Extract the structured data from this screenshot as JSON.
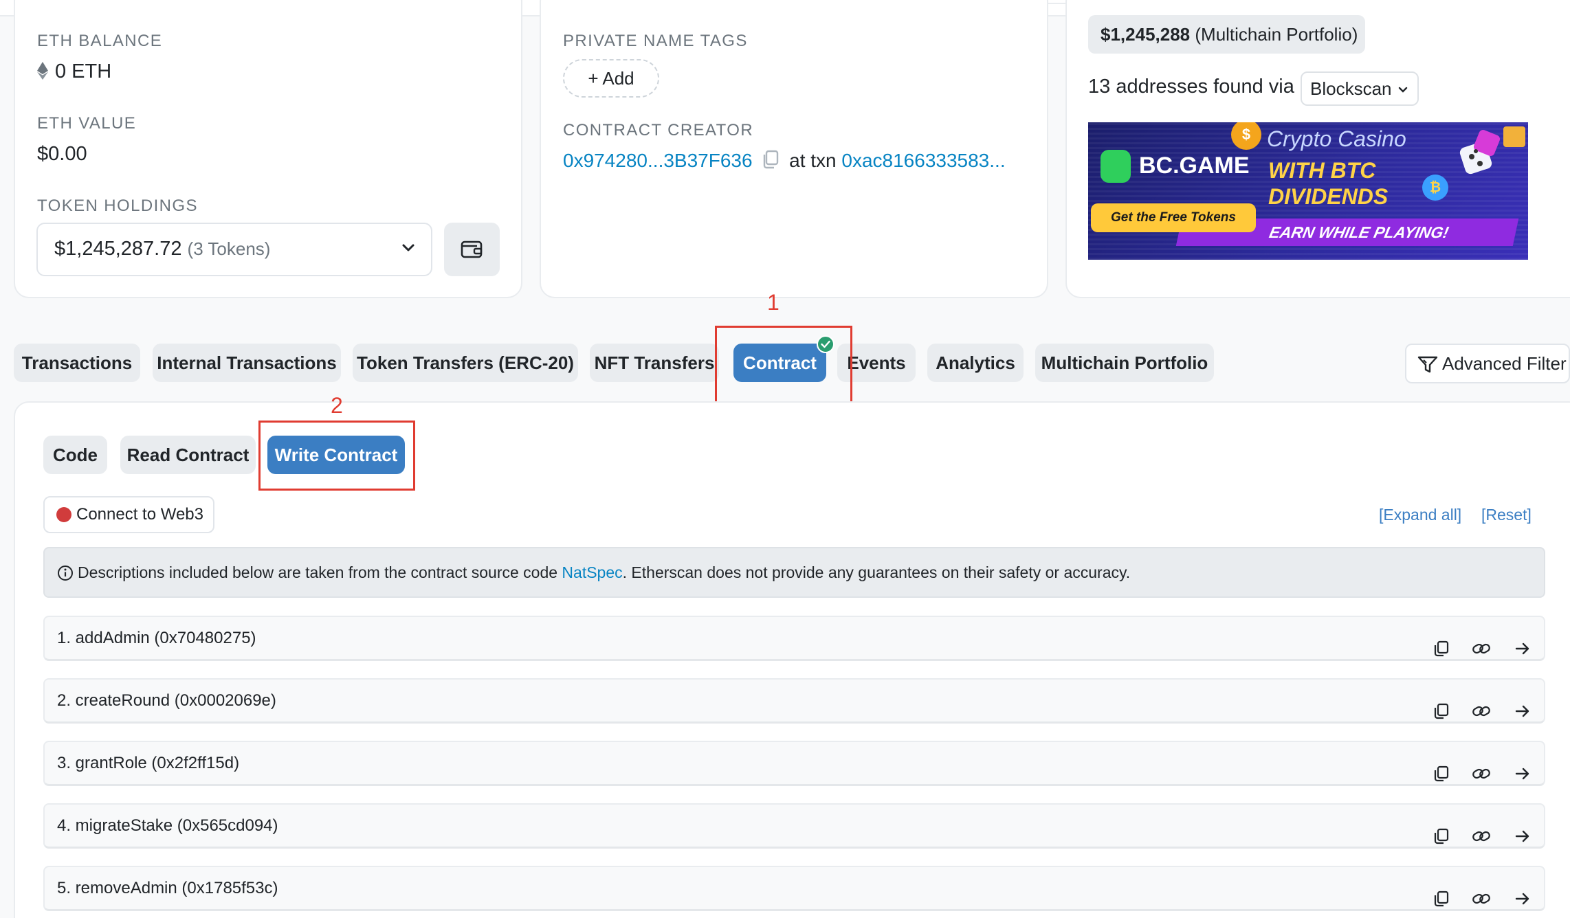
{
  "overview": {
    "eth_balance_label": "ETH BALANCE",
    "eth_balance_value": "0 ETH",
    "eth_value_label": "ETH VALUE",
    "eth_value_value": "$0.00",
    "token_holdings_label": "TOKEN HOLDINGS",
    "token_holdings_value": "$1,245,287.72",
    "token_holdings_count": "(3 Tokens)"
  },
  "more_info": {
    "private_tags_label": "PRIVATE NAME TAGS",
    "add_label": "Add",
    "creator_label": "CONTRACT CREATOR",
    "creator_address": "0x974280...3B37F636",
    "at_txn": "at txn",
    "creator_txn": "0xac8166333583..."
  },
  "multichain": {
    "portfolio_amount": "$1,245,288",
    "portfolio_suffix": "(Multichain Portfolio)",
    "addresses_found": "13 addresses found via",
    "source_selected": "Blockscan"
  },
  "ad": {
    "brand": "BC.GAME",
    "line1": "Crypto Casino",
    "line2": "WITH BTC",
    "line3": "DIVIDENDS",
    "cta": "Get the Free Tokens",
    "tagline": "EARN WHILE PLAYING!"
  },
  "tabs": [
    {
      "label": "Transactions"
    },
    {
      "label": "Internal Transactions"
    },
    {
      "label": "Token Transfers (ERC-20)"
    },
    {
      "label": "NFT Transfers"
    },
    {
      "label": "Contract"
    },
    {
      "label": "Events"
    },
    {
      "label": "Analytics"
    },
    {
      "label": "Multichain Portfolio"
    }
  ],
  "advanced_filter": "Advanced Filter",
  "annotations": {
    "one": "1",
    "two": "2"
  },
  "subtabs": [
    {
      "label": "Code"
    },
    {
      "label": "Read Contract"
    },
    {
      "label": "Write Contract"
    }
  ],
  "connect_label": "Connect to Web3",
  "expand_all": "[Expand all]",
  "reset": "[Reset]",
  "notice": {
    "prefix": "Descriptions included below are taken from the contract source code ",
    "link": "NatSpec",
    "suffix": ". Etherscan does not provide any guarantees on their safety or accuracy."
  },
  "functions": [
    {
      "label": "1. addAdmin (0x70480275)"
    },
    {
      "label": "2. createRound (0x0002069e)"
    },
    {
      "label": "3. grantRole (0x2f2ff15d)"
    },
    {
      "label": "4. migrateStake (0x565cd094)"
    },
    {
      "label": "5. removeAdmin (0x1785f53c)"
    }
  ],
  "colors": {
    "accent": "#3b7ec3",
    "link": "#0784c3",
    "annotation": "#e03c31",
    "verified": "#2a9d6f",
    "web3_dot": "#d13c3c"
  }
}
